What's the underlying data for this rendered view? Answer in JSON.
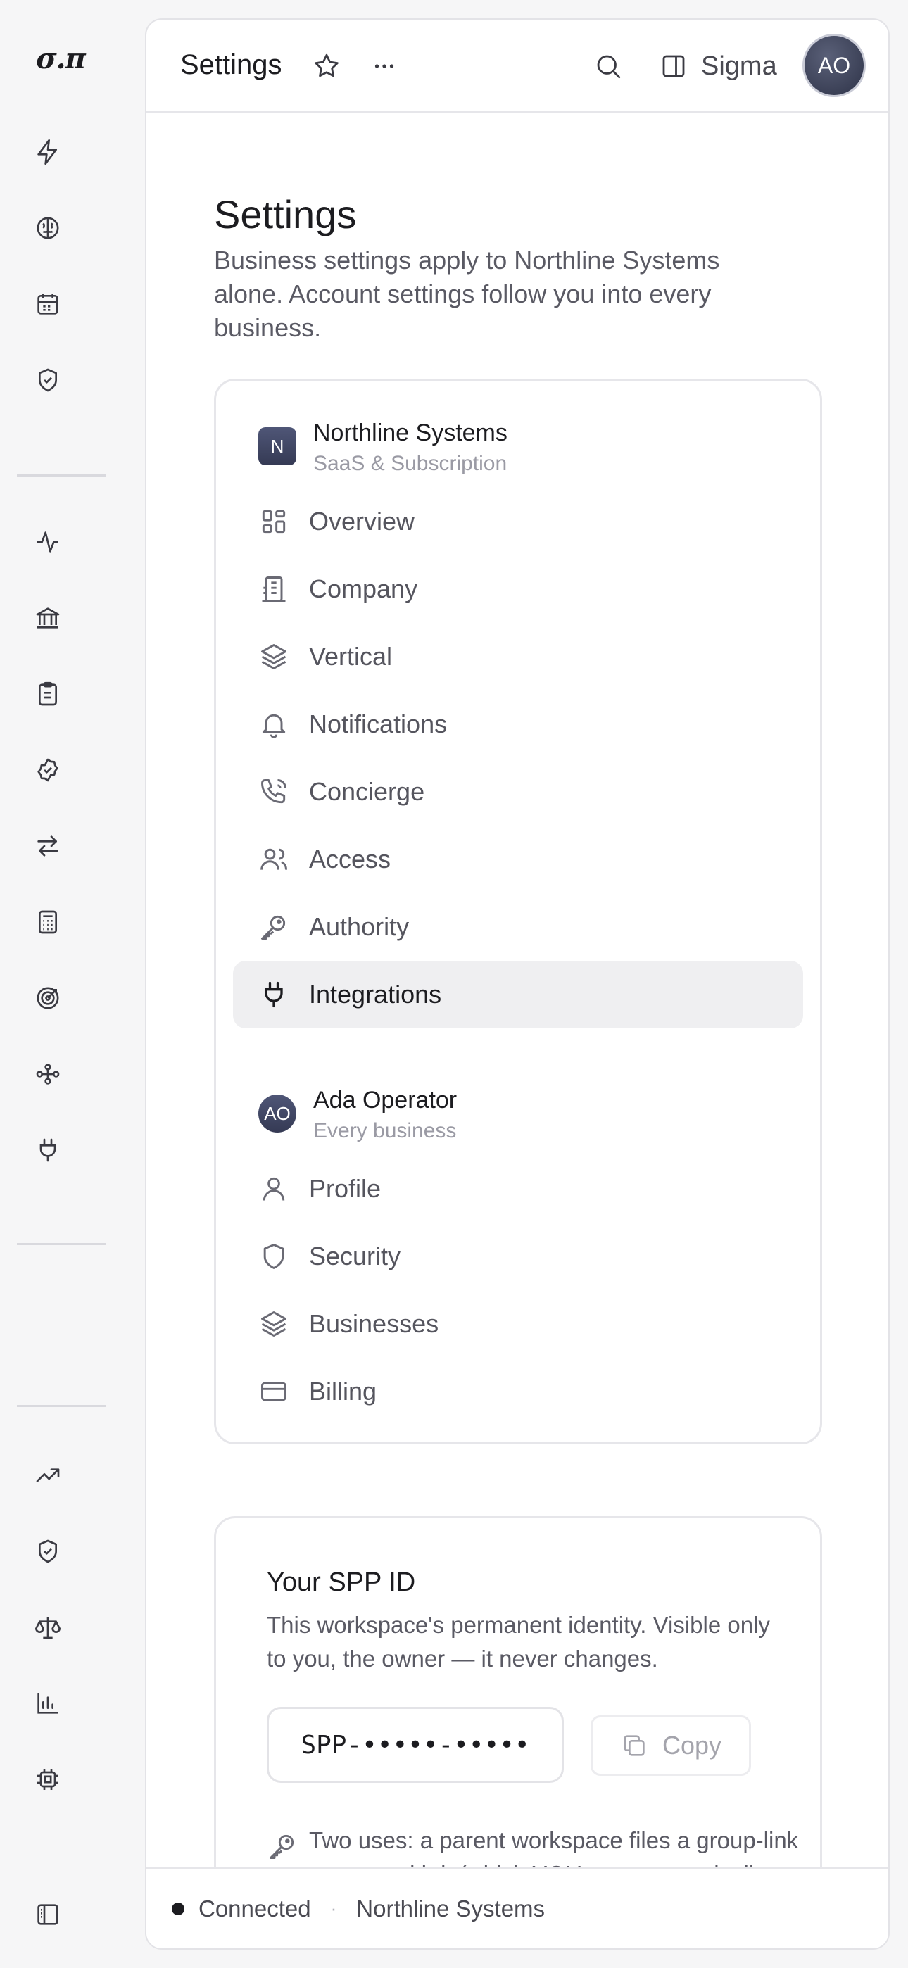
{
  "app": {
    "logo": "σ.π"
  },
  "topbar": {
    "title": "Settings",
    "workspace_label": "Sigma",
    "avatar_initials": "AO"
  },
  "page": {
    "title": "Settings",
    "description": "Business settings apply to Northline Systems alone. Account settings follow you into every business."
  },
  "business_group": {
    "badge": "N",
    "name": "Northline Systems",
    "subtitle": "SaaS & Subscription",
    "items": [
      {
        "label": "Overview",
        "icon": "grid-icon"
      },
      {
        "label": "Company",
        "icon": "building-icon"
      },
      {
        "label": "Vertical",
        "icon": "layers-icon"
      },
      {
        "label": "Notifications",
        "icon": "bell-icon"
      },
      {
        "label": "Concierge",
        "icon": "phone-icon"
      },
      {
        "label": "Access",
        "icon": "users-icon"
      },
      {
        "label": "Authority",
        "icon": "key-icon"
      },
      {
        "label": "Integrations",
        "icon": "plug-icon",
        "active": true
      }
    ]
  },
  "account_group": {
    "badge": "AO",
    "name": "Ada Operator",
    "subtitle": "Every business",
    "items": [
      {
        "label": "Profile",
        "icon": "user-icon"
      },
      {
        "label": "Security",
        "icon": "shield-icon"
      },
      {
        "label": "Businesses",
        "icon": "layers-icon"
      },
      {
        "label": "Billing",
        "icon": "credit-card-icon"
      }
    ]
  },
  "spp": {
    "title": "Your SPP ID",
    "description": "This workspace's permanent identity. Visible only to you, the owner — it never changes.",
    "masked_id": "SPP-•••••-•••••",
    "copy_label": "Copy",
    "note": "Two uses: a parent workspace files a group-link request with it (which YOU approve or decline below), and it identifies"
  },
  "status": {
    "connection": "Connected",
    "separator": "·",
    "workspace": "Northline Systems"
  },
  "colors": {
    "accent": "#1c1c20",
    "badge": "#3f4560",
    "active_bg": "#efeff1"
  }
}
